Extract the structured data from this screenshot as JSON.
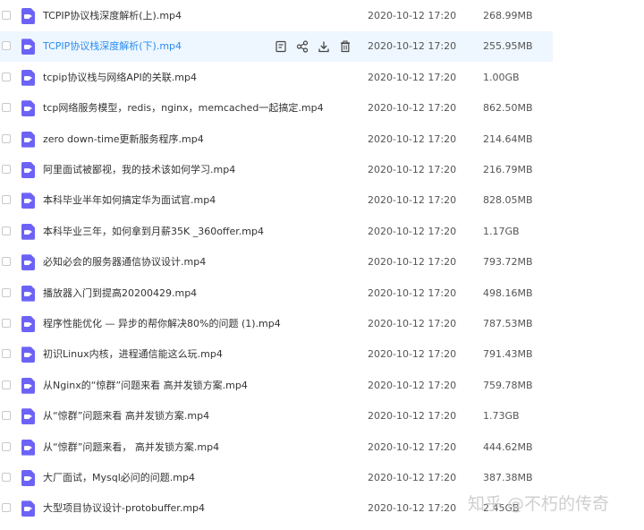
{
  "files": [
    {
      "name": "TCPIP协议栈深度解析(上).mp4",
      "date": "2020-10-12 17:20",
      "size": "268.99MB"
    },
    {
      "name": "TCPIP协议栈深度解析(下).mp4",
      "date": "2020-10-12 17:20",
      "size": "255.95MB"
    },
    {
      "name": "tcpip协议栈与网络API的关联.mp4",
      "date": "2020-10-12 17:20",
      "size": "1.00GB"
    },
    {
      "name": "tcp网络服务模型，redis，nginx，memcached一起搞定.mp4",
      "date": "2020-10-12 17:20",
      "size": "862.50MB"
    },
    {
      "name": "zero down-time更新服务程序.mp4",
      "date": "2020-10-12 17:20",
      "size": "214.64MB"
    },
    {
      "name": "阿里面试被鄙视，我的技术该如何学习.mp4",
      "date": "2020-10-12 17:20",
      "size": "216.79MB"
    },
    {
      "name": "本科毕业半年如何搞定华为面试官.mp4",
      "date": "2020-10-12 17:20",
      "size": "828.05MB"
    },
    {
      "name": "本科毕业三年，如何拿到月薪35K _360offer.mp4",
      "date": "2020-10-12 17:20",
      "size": "1.17GB"
    },
    {
      "name": "必知必会的服务器通信协议设计.mp4",
      "date": "2020-10-12 17:20",
      "size": "793.72MB"
    },
    {
      "name": "播放器入门到提高20200429.mp4",
      "date": "2020-10-12 17:20",
      "size": "498.16MB"
    },
    {
      "name": "程序性能优化 — 异步的帮你解决80%的问题 (1).mp4",
      "date": "2020-10-12 17:20",
      "size": "787.53MB"
    },
    {
      "name": "初识Linux内核，进程通信能这么玩.mp4",
      "date": "2020-10-12 17:20",
      "size": "791.43MB"
    },
    {
      "name": "从Nginx的“惊群”问题来看 高并发锁方案.mp4",
      "date": "2020-10-12 17:20",
      "size": "759.78MB"
    },
    {
      "name": "从“惊群”问题来看 高并发锁方案.mp4",
      "date": "2020-10-12 17:20",
      "size": "1.73GB"
    },
    {
      "name": "从“惊群”问题来看， 高并发锁方案.mp4",
      "date": "2020-10-12 17:20",
      "size": "444.62MB"
    },
    {
      "name": "大厂面试，Mysql必问的问题.mp4",
      "date": "2020-10-12 17:20",
      "size": "387.38MB"
    },
    {
      "name": "大型项目协议设计-protobuffer.mp4",
      "date": "2020-10-12 17:20",
      "size": "2.45GB"
    }
  ],
  "hover_row_index": 1,
  "watermark": "知乎 @不朽的传奇",
  "colors": {
    "hover_bg": "#eef7ff",
    "link_blue": "#2b8cf0",
    "file_icon": "#6c63f6"
  },
  "row_actions": [
    "edit-icon",
    "share-icon",
    "download-icon",
    "delete-icon"
  ]
}
